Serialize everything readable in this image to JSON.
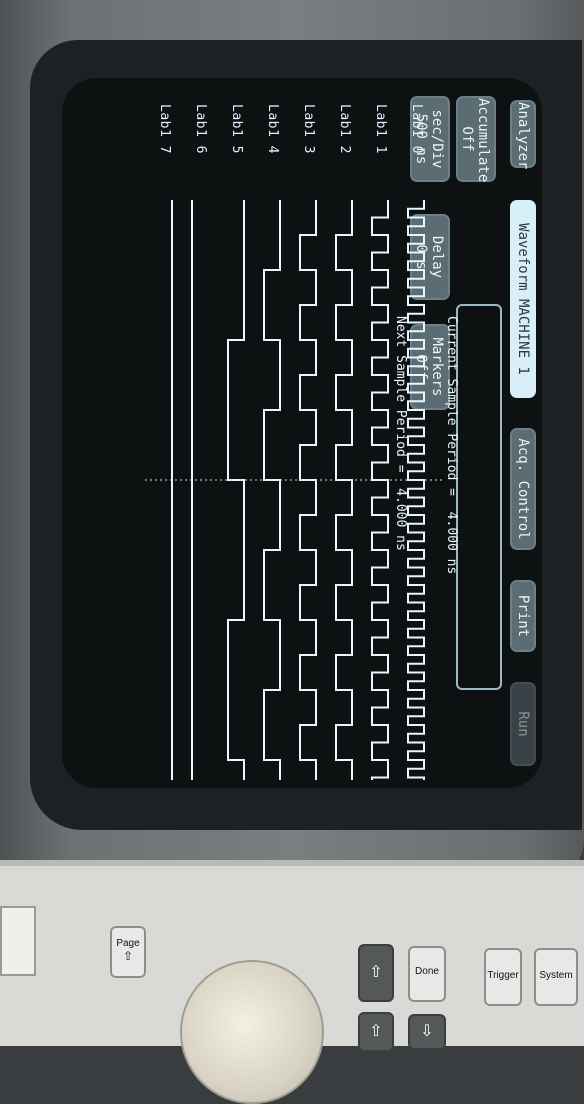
{
  "buttons": {
    "analyzer": "Analyzer",
    "waveform": "Waveform MACHINE 1",
    "acq_control": "Acq. Control",
    "print": "Print",
    "run": "Run",
    "accumulate_title": "Accumulate",
    "accumulate_value": "Off",
    "sec_div_title": "sec/Div",
    "sec_div_value": "500 ns",
    "delay_title": "Delay",
    "delay_value": "0 s",
    "markers_title": "Markers",
    "markers_value": "Off"
  },
  "sample_info": {
    "current": "Current Sample Period =  4.000 ns",
    "next": "Next Sample Period =  4.000 ns"
  },
  "channels": [
    {
      "label": "Lab1",
      "index": "0",
      "period_div": 2
    },
    {
      "label": "Lab1",
      "index": "1",
      "period_div": 4
    },
    {
      "label": "Lab1",
      "index": "2",
      "period_div": 8
    },
    {
      "label": "Lab1",
      "index": "3",
      "period_div": 8
    },
    {
      "label": "Lab1",
      "index": "4",
      "period_div": 16
    },
    {
      "label": "Lab1",
      "index": "5",
      "period_div": 32
    },
    {
      "label": "Lab1",
      "index": "6",
      "period_div": 0
    },
    {
      "label": "Lab1",
      "index": "7",
      "period_div": 0
    }
  ],
  "panel_keys": {
    "page": "Page",
    "done": "Done",
    "trigger": "Trigger",
    "system": "System"
  },
  "colors": {
    "screen_fg": "#dff2ff",
    "trace": "#e8f6ff",
    "button_bg": "#5b6c73"
  }
}
